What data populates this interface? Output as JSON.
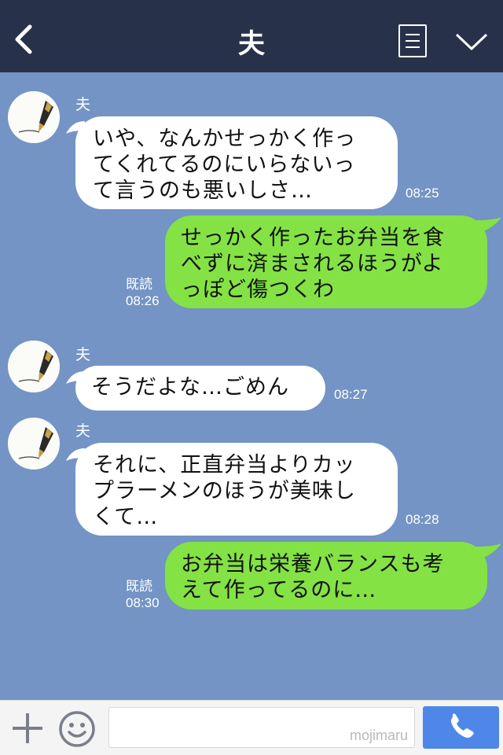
{
  "header": {
    "title": "夫",
    "back_icon": "chevron-left-icon",
    "menu_icon": "note-list-icon",
    "more_icon": "chevron-down-icon"
  },
  "messages": [
    {
      "side": "in",
      "sender": "夫",
      "lines": [
        "いや、なんかせっかく作っ",
        "てくれてるのにいらないっ",
        "て言うのも悪いしさ…"
      ],
      "time": "08:25"
    },
    {
      "side": "out",
      "read": "既読",
      "lines": [
        "せっかく作ったお弁当を食",
        "べずに済まされるほうがよ",
        "っぽど傷つくわ"
      ],
      "time": "08:26"
    },
    {
      "side": "in",
      "sender": "夫",
      "lines": [
        "そうだよな…ごめん"
      ],
      "time": "08:27"
    },
    {
      "side": "in",
      "sender": "夫",
      "lines": [
        "それに、正直弁当よりカッ",
        "プラーメンのほうが美味し",
        "くて…"
      ],
      "time": "08:28"
    },
    {
      "side": "out",
      "read": "既読",
      "lines": [
        "お弁当は栄養バランスも考",
        "えて作ってるのに…"
      ],
      "time": "08:30"
    }
  ],
  "footer": {
    "input_value": "",
    "input_placeholder": "",
    "watermark": "mojimaru",
    "plus_icon": "plus-icon",
    "emoji_icon": "smiley-icon",
    "call_icon": "phone-icon"
  },
  "colors": {
    "header_bg": "#27324a",
    "chat_bg": "#7394c4",
    "incoming_bubble": "#ffffff",
    "outgoing_bubble": "#84e245",
    "call_button": "#4f87e8"
  }
}
